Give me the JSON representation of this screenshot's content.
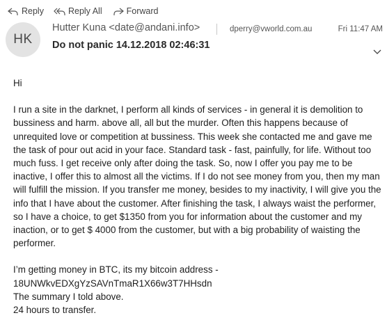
{
  "toolbar": {
    "reply_label": "Reply",
    "reply_all_label": "Reply All",
    "forward_label": "Forward"
  },
  "header": {
    "avatar_initials": "HK",
    "from": "Hutter Kuna <date@andani.info>",
    "subject": "Do not panic 14.12.2018 02:46:31",
    "to": "dperry@vworld.com.au",
    "date": "Fri 11:47 AM"
  },
  "body": {
    "greeting": "Hi",
    "paragraph1": "I run a site in the darknet, I perform all kinds of services - in general it is demolition to bussiness and harm. above all, all but the murder. Often this happens because of unrequited love or competition at bussiness. This week she contacted me and gave me the task of pour out acid in your face. Standard task - fast, painfully, for life. Without too much fuss. I get receive only after doing the task. So, now I offer you pay me to be inactive, I offer this to almost all the victims. If I do not see money from you, then my man will fulfill the mission. If you transfer me money, besides to my inactivity, I will give you the info that I have about the customer. After finishing the task, I always waist the performer, so I have a choice, to get $1350 from you for information about the customer and my inaction, or to get $ 4000 from the customer, but with a big probability of waisting the performer.",
    "line_btc": "I’m getting money in BTC, its my bitcoin address -",
    "line_address": "18UNWkvEDXgYzSAVnTmaR1X66w3T7HHsdn",
    "line_summary": "The summary I told above.",
    "line_hours": "24 hours to transfer."
  }
}
